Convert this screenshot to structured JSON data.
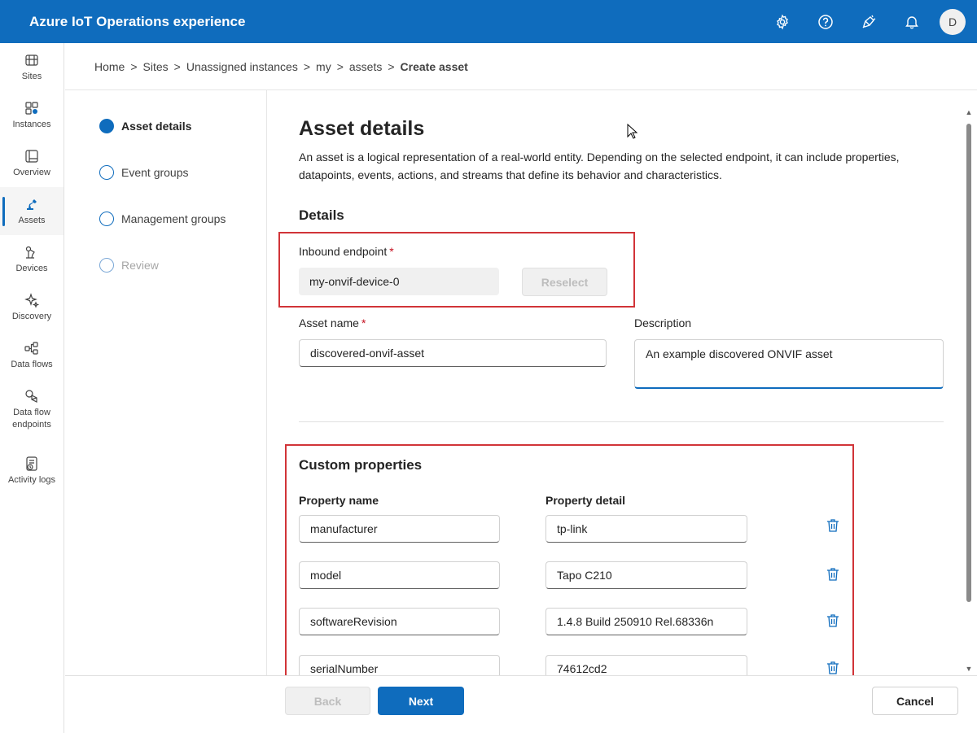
{
  "app": {
    "title": "Azure IoT Operations experience",
    "avatar_initial": "D"
  },
  "topbar_icons": [
    "gear-icon",
    "help-icon",
    "feedback-icon",
    "bell-icon"
  ],
  "nav": [
    {
      "label": "Sites",
      "icon": "sites-icon"
    },
    {
      "label": "Instances",
      "icon": "instances-icon"
    },
    {
      "label": "Overview",
      "icon": "overview-icon"
    },
    {
      "label": "Assets",
      "icon": "assets-icon",
      "active": true
    },
    {
      "label": "Devices",
      "icon": "devices-icon"
    },
    {
      "label": "Discovery",
      "icon": "discovery-icon"
    },
    {
      "label": "Data flows",
      "icon": "dataflows-icon"
    },
    {
      "label": "Data flow endpoints",
      "icon": "dataflow-endpoints-icon"
    },
    {
      "label": "Activity logs",
      "icon": "activity-logs-icon"
    }
  ],
  "breadcrumb": {
    "items": [
      "Home",
      "Sites",
      "Unassigned instances",
      "my",
      "assets"
    ],
    "current": "Create asset",
    "separator": ">"
  },
  "steps": [
    {
      "label": "Asset details",
      "state": "active"
    },
    {
      "label": "Event groups",
      "state": "pending"
    },
    {
      "label": "Management groups",
      "state": "pending"
    },
    {
      "label": "Review",
      "state": "disabled"
    }
  ],
  "main": {
    "title": "Asset details",
    "intro": "An asset is a logical representation of a real-world entity. Depending on the selected endpoint, it can include properties, datapoints, events, actions, and streams that define its behavior and characteristics.",
    "details_heading": "Details",
    "inbound_endpoint_label": "Inbound endpoint",
    "inbound_endpoint_value": "my-onvif-device-0",
    "reselect_label": "Reselect",
    "asset_name_label": "Asset name",
    "asset_name_value": "discovered-onvif-asset",
    "description_label": "Description",
    "description_value": "An example discovered ONVIF asset",
    "required_mark": "*",
    "custom_heading": "Custom properties",
    "col_property_name": "Property name",
    "col_property_detail": "Property detail",
    "properties": [
      {
        "name": "manufacturer",
        "detail": "tp-link"
      },
      {
        "name": "model",
        "detail": "Tapo C210"
      },
      {
        "name": "softwareRevision",
        "detail": "1.4.8 Build 250910 Rel.68336n"
      },
      {
        "name": "serialNumber",
        "detail": "74612cd2"
      }
    ]
  },
  "footer": {
    "back": "Back",
    "next": "Next",
    "cancel": "Cancel"
  },
  "colors": {
    "brand": "#0f6cbd",
    "highlight": "#d13438",
    "required": "#c50f1f"
  }
}
